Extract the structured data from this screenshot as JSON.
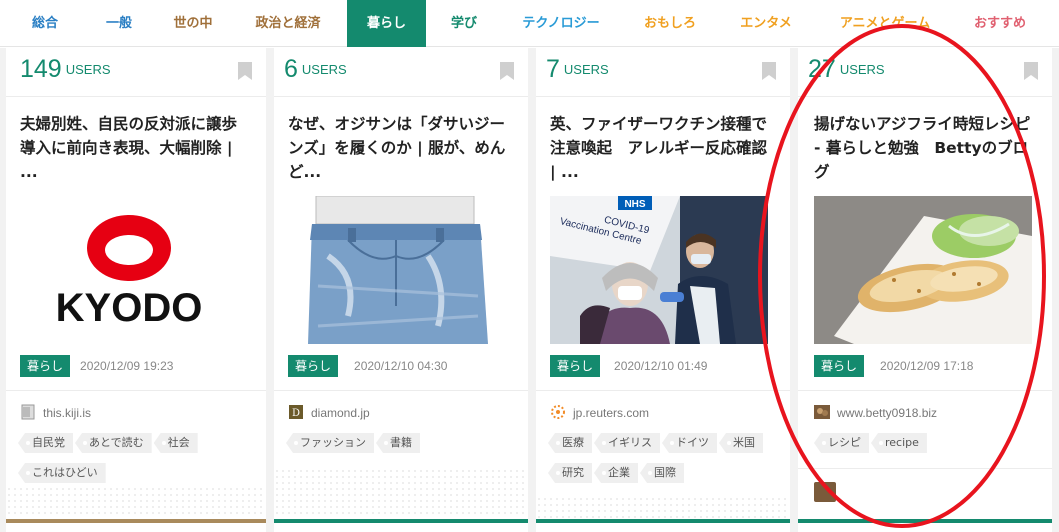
{
  "nav": {
    "items": [
      {
        "label": "総合",
        "color": "#2a7fc4",
        "active": false
      },
      {
        "label": "一般",
        "color": "#2a7fc4",
        "active": false
      },
      {
        "label": "世の中",
        "color": "#a0703a",
        "active": false
      },
      {
        "label": "政治と経済",
        "color": "#a0703a",
        "active": false
      },
      {
        "label": "暮らし",
        "color": "#ffffff",
        "active": true
      },
      {
        "label": "学び",
        "color": "#148a6e",
        "active": false
      },
      {
        "label": "テクノロジー",
        "color": "#2a9bd6",
        "active": false
      },
      {
        "label": "おもしろ",
        "color": "#f0a020",
        "active": false
      },
      {
        "label": "エンタメ",
        "color": "#f0a020",
        "active": false
      },
      {
        "label": "アニメとゲーム",
        "color": "#f0a020",
        "active": false
      },
      {
        "label": "おすすめ",
        "color": "#e06070",
        "active": false
      }
    ]
  },
  "users_unit": "USERS",
  "entries": [
    {
      "users": "149",
      "title": "夫婦別姓、自民の反対派に譲歩　導入に前向き表現、大幅削除 | ...",
      "category": "暮らし",
      "date": "2020/12/09 19:23",
      "source": "this.kiji.is",
      "favicon": "page-icon",
      "thumb": "kyodo-logo",
      "thumb_text": "KYODO",
      "tags": [
        "自民党",
        "あとで読む",
        "社会",
        "これはひどい"
      ],
      "bar_color": "#a98a5c"
    },
    {
      "users": "6",
      "title": "なぜ、オジサンは「ダサいジーンズ」を履くのか | 服が、めんど...",
      "category": "暮らし",
      "date": "2020/12/10 04:30",
      "source": "diamond.jp",
      "favicon": "diamond-icon",
      "thumb": "jeans-illustration",
      "tags": [
        "ファッション",
        "書籍"
      ],
      "bar_color": "#148a6e"
    },
    {
      "users": "7",
      "title": "英、ファイザーワクチン接種で注意喚起　アレルギー反応確認 | ...",
      "category": "暮らし",
      "date": "2020/12/10 01:49",
      "source": "jp.reuters.com",
      "favicon": "reuters-icon",
      "thumb": "vaccination-photo",
      "thumb_text_1": "NHS",
      "thumb_text_2": "COVID-19",
      "thumb_text_3": "Vaccination Centre",
      "tags": [
        "医療",
        "イギリス",
        "ドイツ",
        "米国",
        "研究",
        "企業",
        "国際"
      ],
      "bar_color": "#148a6e"
    },
    {
      "users": "27",
      "title": "揚げないアジフライ時短レシピ - 暮らしと勉強　Bettyのブログ",
      "category": "暮らし",
      "date": "2020/12/09 17:18",
      "source": "www.betty0918.biz",
      "favicon": "blog-avatar-icon",
      "thumb": "fried-fish-photo",
      "tags": [
        "レシピ",
        "recipe"
      ],
      "bar_color": "#148a6e"
    }
  ],
  "colors": {
    "accent": "#148a6e",
    "annotation": "#e8141e"
  }
}
